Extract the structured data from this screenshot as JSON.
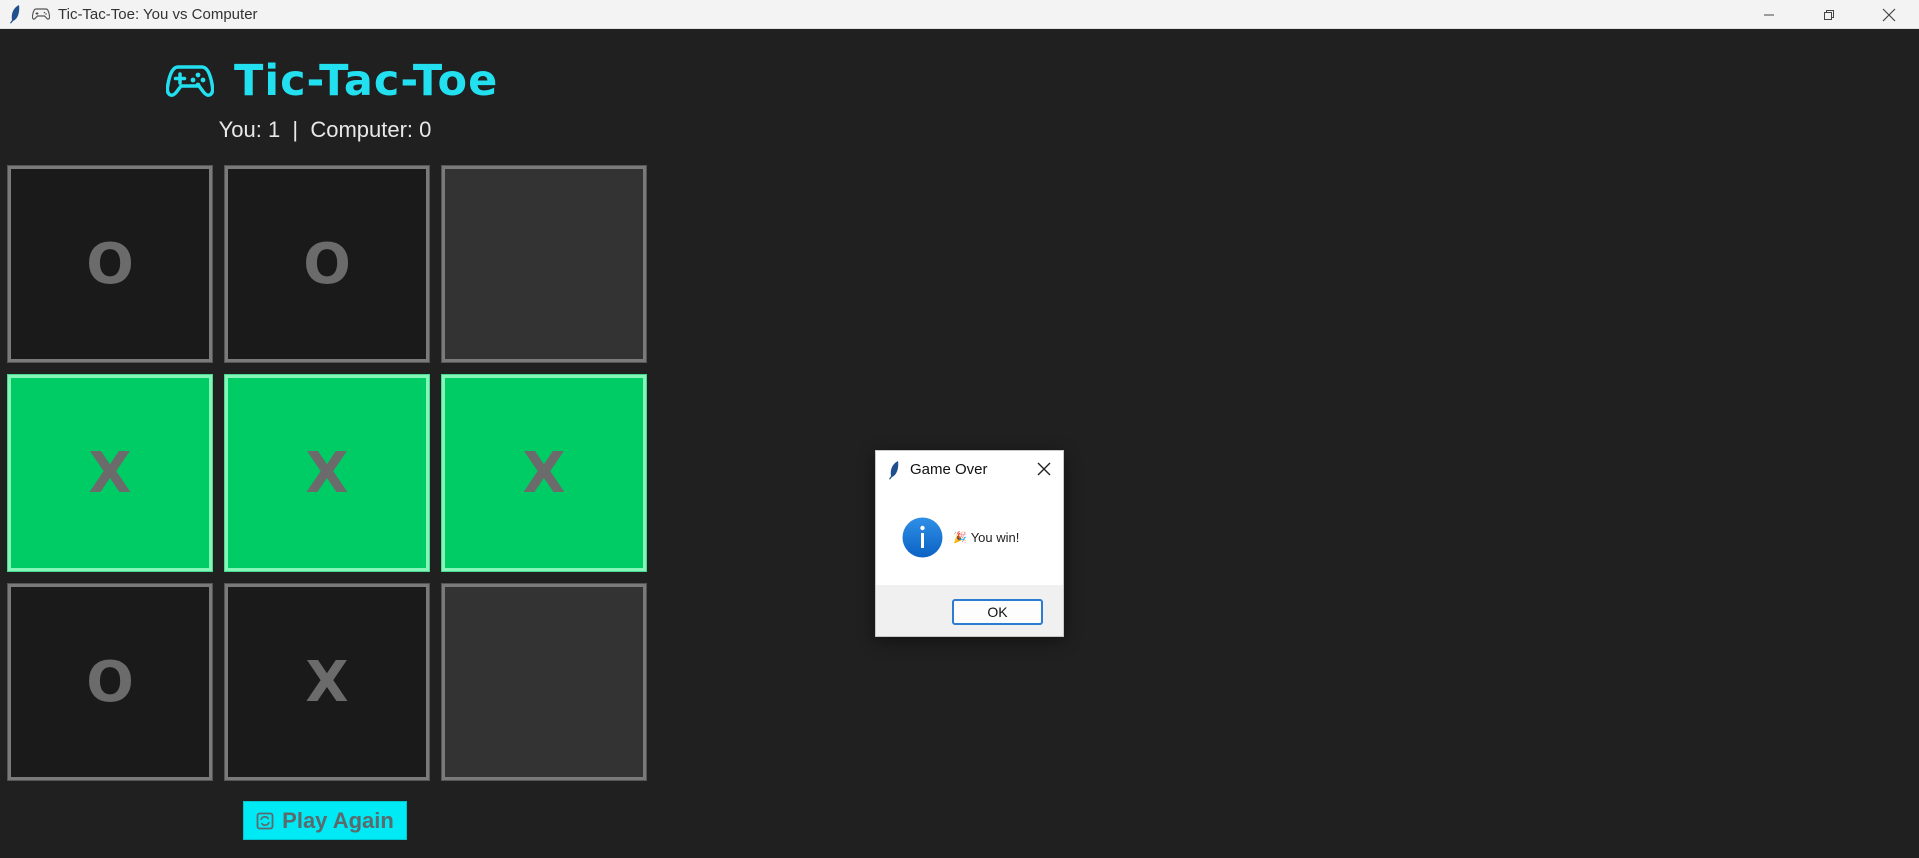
{
  "window": {
    "title": "Tic-Tac-Toe: You vs Computer"
  },
  "app": {
    "heading": "Tic-Tac-Toe",
    "score_text": "You: 1  |  Computer: 0",
    "board": [
      {
        "mark": "O",
        "state": "normal"
      },
      {
        "mark": "O",
        "state": "normal"
      },
      {
        "mark": "",
        "state": "empty"
      },
      {
        "mark": "X",
        "state": "win"
      },
      {
        "mark": "X",
        "state": "win"
      },
      {
        "mark": "X",
        "state": "win"
      },
      {
        "mark": "O",
        "state": "normal"
      },
      {
        "mark": "X",
        "state": "normal"
      },
      {
        "mark": "",
        "state": "empty"
      }
    ],
    "play_again_label": "Play Again"
  },
  "dialog": {
    "title": "Game Over",
    "message": "You win!",
    "ok_label": "OK"
  },
  "colors": {
    "accent": "#22e0f0",
    "win": "#00cc66",
    "button": "#00eaf5",
    "background": "#202020"
  }
}
